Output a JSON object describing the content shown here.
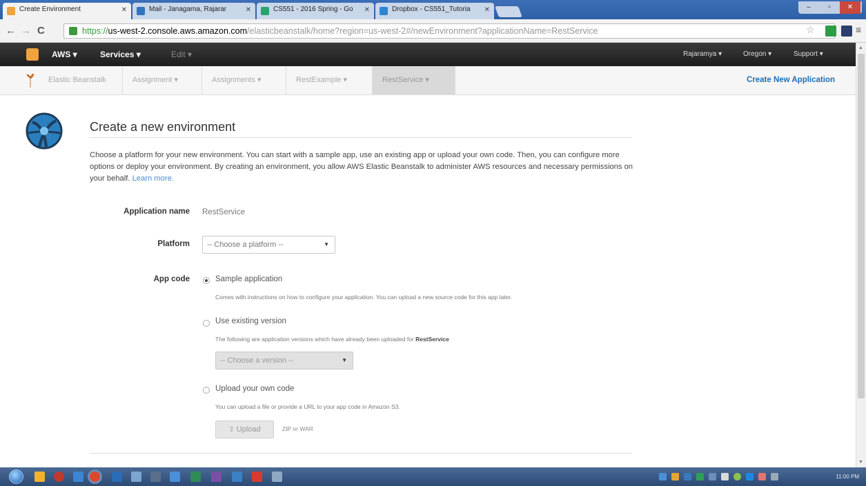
{
  "browser": {
    "tabs": [
      {
        "label": "Create Environment",
        "favicon_color": "#f0a23c",
        "active": true
      },
      {
        "label": "Mail - Janagama, Rajarar",
        "favicon_color": "#2f74c0",
        "active": false
      },
      {
        "label": "CS551 - 2016 Spring - Go",
        "favicon_color": "#2aa36b",
        "active": false
      },
      {
        "label": "Dropbox - CS551_Tutoria",
        "favicon_color": "#2b86d6",
        "active": false
      }
    ],
    "url": {
      "scheme": "https://",
      "host": "us-west-2.console.aws.amazon.com",
      "path": "/elasticbeanstalk/home?region=us-west-2#/newEnvironment?applicationName=RestService"
    }
  },
  "aws_header": {
    "brand": "AWS",
    "services": "Services",
    "edit": "Edit",
    "user": "Rajaramya",
    "region": "Oregon",
    "support": "Support"
  },
  "subnav": {
    "items": [
      {
        "label": "Elastic Beanstalk"
      },
      {
        "label": "Assignment"
      },
      {
        "label": "Assignments"
      },
      {
        "label": "RestExample"
      },
      {
        "label": "RestService"
      }
    ],
    "create_app": "Create New Application"
  },
  "main": {
    "title": "Create a new environment",
    "intro": "Choose a platform for your new environment. You can start with a sample app, use an existing app or upload your own code. Then, you can configure more options or deploy your environment. By creating an environment, you allow AWS Elastic Beanstalk to administer AWS resources and necessary permissions on your behalf.",
    "learn_more": "Learn more.",
    "app_name_label": "Application name",
    "app_name_value": "RestService",
    "platform_label": "Platform",
    "platform_select": "-- Choose a platform --",
    "app_code_label": "App code",
    "options": {
      "sample": "Sample application",
      "sample_help": "Comes with instructions on how to configure your application. You can upload a new source code for this app later.",
      "existing": "Use existing version",
      "existing_help": "The following are application versions which have already been uploaded for",
      "existing_help_app": "RestService",
      "version_select": "-- Choose a version --",
      "upload": "Upload your own code",
      "upload_help": "You can upload a file or provide a URL to your app code in Amazon S3.",
      "upload_button": "Upload",
      "upload_formats": "ZIP or WAR"
    }
  },
  "taskbar": {
    "clock": "11:00 PM"
  }
}
